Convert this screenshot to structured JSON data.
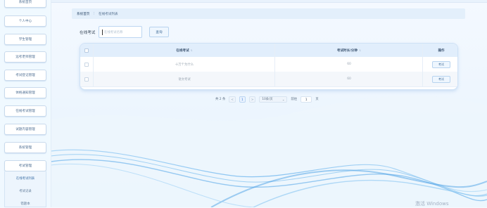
{
  "sidebar": {
    "items": [
      {
        "label": "系统首页"
      },
      {
        "label": "个人中心"
      },
      {
        "label": "学生管理"
      },
      {
        "label": "远考老师管理"
      },
      {
        "label": "考试登记管理"
      },
      {
        "label": "体格通知管理"
      },
      {
        "label": "在线考试管理"
      },
      {
        "label": "试题内容管理"
      },
      {
        "label": "系统管理"
      },
      {
        "label": "考试管理"
      }
    ],
    "subitems": [
      {
        "label": "在线考试列表"
      },
      {
        "label": "考试记录"
      },
      {
        "label": "错题本"
      }
    ]
  },
  "breadcrumb": {
    "home": "系统首页",
    "separator": "⋮",
    "current": "在线考试列表"
  },
  "search": {
    "label": "在线考试",
    "placeholder": "在线考试名称",
    "button": "查询"
  },
  "table": {
    "columns": [
      "在线考试",
      "考试时长/分钟",
      "操作"
    ],
    "rows": [
      {
        "name": "十万个为什么",
        "duration": "60",
        "action": "考试"
      },
      {
        "name": "语文考试",
        "duration": "60",
        "action": "考试"
      }
    ]
  },
  "pagination": {
    "total": "共 2 条",
    "prev": "<",
    "current_page": "1",
    "next": ">",
    "page_size": "10条/页",
    "goto_prefix": "前往",
    "goto_value": "1",
    "goto_suffix": "页"
  },
  "watermark": "激活 Windows",
  "colors": {
    "accent": "#3a7bd5",
    "panel": "#e1eefc",
    "background": "#f4f9ff"
  }
}
